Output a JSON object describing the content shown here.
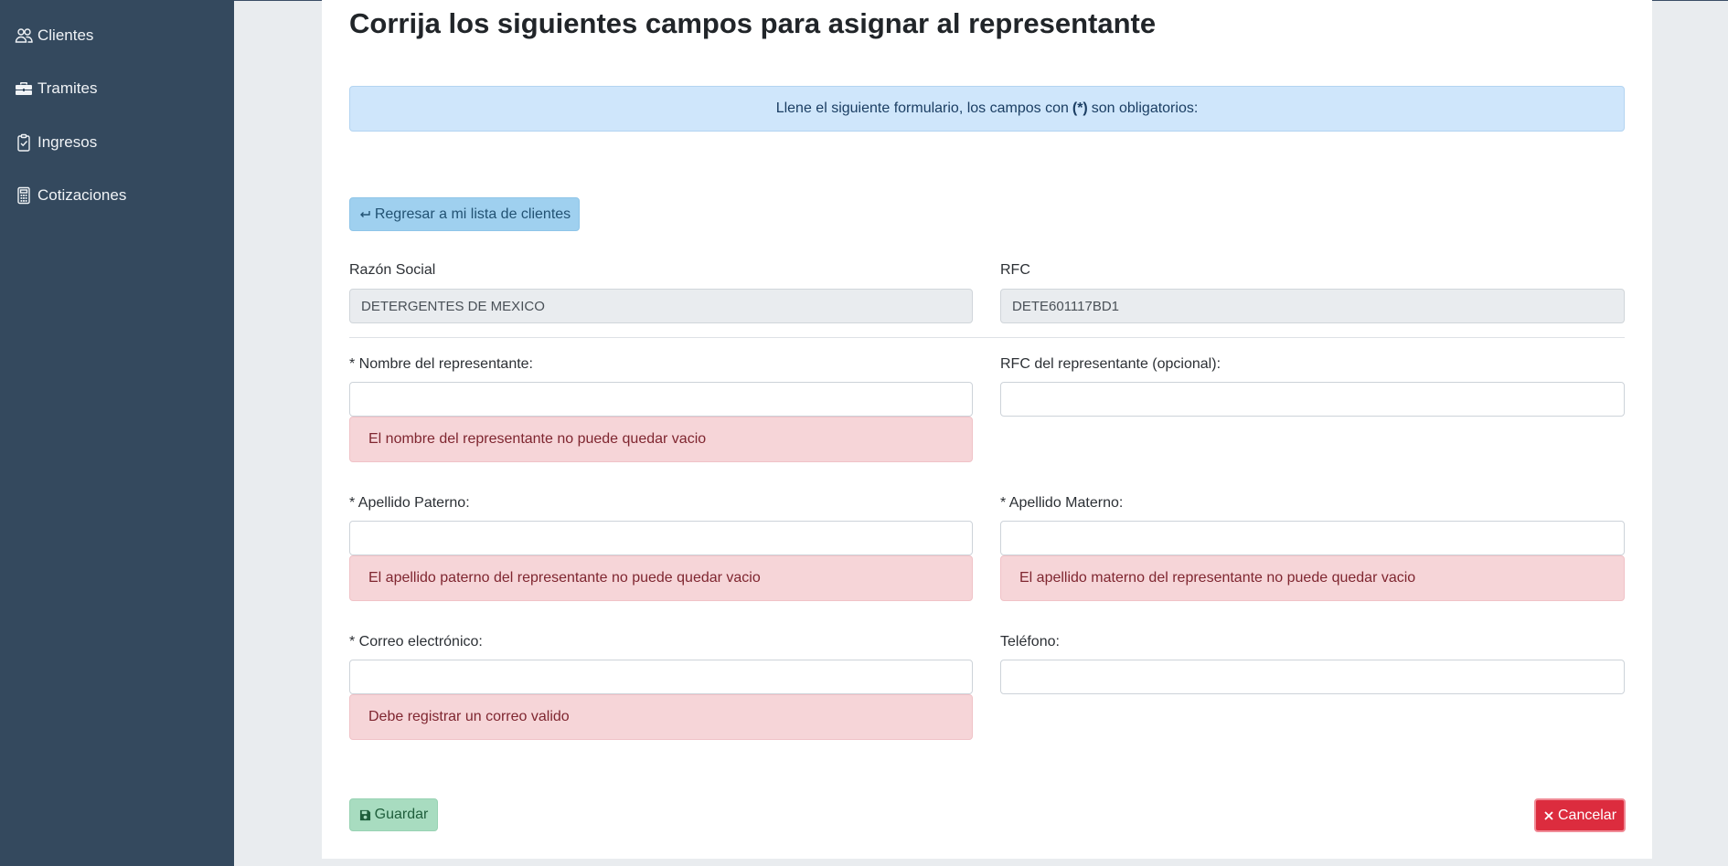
{
  "sidebar": {
    "items": [
      {
        "label": "Clientes",
        "icon": "users-icon"
      },
      {
        "label": "Tramites",
        "icon": "briefcase-icon"
      },
      {
        "label": "Ingresos",
        "icon": "clipboard-check-icon"
      },
      {
        "label": "Cotizaciones",
        "icon": "calculator-icon"
      }
    ]
  },
  "page": {
    "title": "Corrija los siguientes campos para asignar al representante",
    "info_before": "Llene el siguiente formulario, los campos con",
    "info_mark": "(*)",
    "info_after": "son obligatorios:",
    "back_label": "Regresar a mi lista de clientes"
  },
  "company": {
    "razon_label": "Razón Social",
    "razon_value": "DETERGENTES DE MEXICO",
    "rfc_label": "RFC",
    "rfc_value": "DETE601117BD1"
  },
  "form": {
    "nombre_label": "* Nombre del representante:",
    "nombre_value": "",
    "nombre_error": "El nombre del representante no puede quedar vacio",
    "rfc_rep_label": "RFC del representante (opcional):",
    "rfc_rep_value": "",
    "paterno_label": "* Apellido Paterno:",
    "paterno_value": "",
    "paterno_error": "El apellido paterno del representante no puede quedar vacio",
    "materno_label": "* Apellido Materno:",
    "materno_value": "",
    "materno_error": "El apellido materno del representante no puede quedar vacio",
    "correo_label": "* Correo electrónico:",
    "correo_value": "",
    "correo_error": "Debe registrar un correo valido",
    "telefono_label": "Teléfono:",
    "telefono_value": ""
  },
  "actions": {
    "save_label": "Guardar",
    "cancel_label": "Cancelar"
  },
  "colors": {
    "sidebar": "#34495e",
    "info": "#cfe6fb",
    "error": "#f6d5d8",
    "save": "#a8dcc0",
    "cancel": "#dc2c3e"
  }
}
